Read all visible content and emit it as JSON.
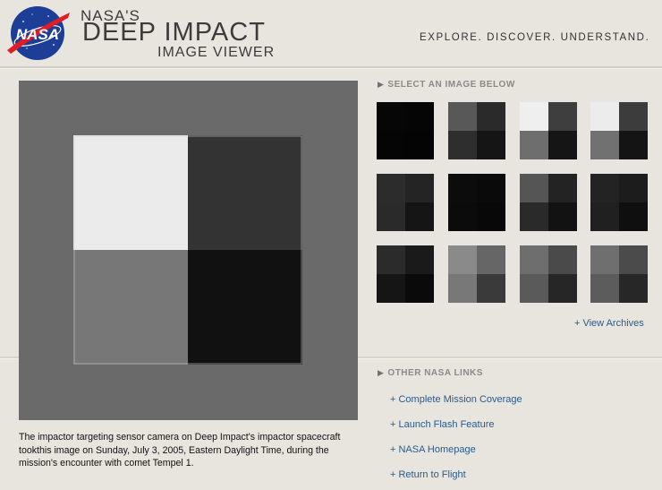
{
  "header": {
    "logo_text": "NASA",
    "title_small": "NASA'S",
    "title_big": "DEEP IMPACT",
    "title_sub": "IMAGE VIEWER",
    "tagline": "EXPLORE.  DISCOVER.  UNDERSTAND."
  },
  "viewer": {
    "quadrants": {
      "top_left": "#ebebeb",
      "top_right": "#333333",
      "bottom_left": "#777777",
      "bottom_right": "#111111"
    },
    "caption": "The impactor targeting sensor camera on Deep Impact's impactor spacecraft tookthis image on Sunday, July 3, 2005, Eastern Daylight Time, during the mission's encounter with comet Tempel 1."
  },
  "thumbnails_section": {
    "heading": "SELECT AN IMAGE BELOW",
    "thumbnails": [
      {
        "tl": "#060606",
        "tr": "#050505",
        "bl": "#050505",
        "br": "#040404"
      },
      {
        "tl": "#585858",
        "tr": "#2a2a2a",
        "bl": "#2e2e2e",
        "br": "#151515"
      },
      {
        "tl": "#efefef",
        "tr": "#3e3e3e",
        "bl": "#6e6e6e",
        "br": "#151515"
      },
      {
        "tl": "#ececec",
        "tr": "#3c3c3c",
        "bl": "#717171",
        "br": "#141414"
      },
      {
        "tl": "#2c2c2c",
        "tr": "#242424",
        "bl": "#2a2a2a",
        "br": "#151515"
      },
      {
        "tl": "#0c0c0c",
        "tr": "#0a0a0a",
        "bl": "#0b0b0b",
        "br": "#080808"
      },
      {
        "tl": "#555555",
        "tr": "#232323",
        "bl": "#2a2a2a",
        "br": "#121212"
      },
      {
        "tl": "#232323",
        "tr": "#1c1c1c",
        "bl": "#202020",
        "br": "#0f0f0f"
      },
      {
        "tl": "#2b2b2b",
        "tr": "#1a1a1a",
        "bl": "#151515",
        "br": "#0a0a0a"
      },
      {
        "tl": "#8a8a8a",
        "tr": "#666666",
        "bl": "#787878",
        "br": "#3a3a3a"
      },
      {
        "tl": "#6e6e6e",
        "tr": "#4a4a4a",
        "bl": "#5a5a5a",
        "br": "#262626"
      },
      {
        "tl": "#6f6f6f",
        "tr": "#4b4b4b",
        "bl": "#5c5c5c",
        "br": "#272727"
      }
    ],
    "archives_link": "+ View Archives"
  },
  "links_section": {
    "heading": "OTHER NASA LINKS",
    "links": [
      "+ Complete Mission Coverage",
      "+ Launch Flash Feature",
      "+ NASA Homepage",
      "+ Return to Flight"
    ]
  }
}
